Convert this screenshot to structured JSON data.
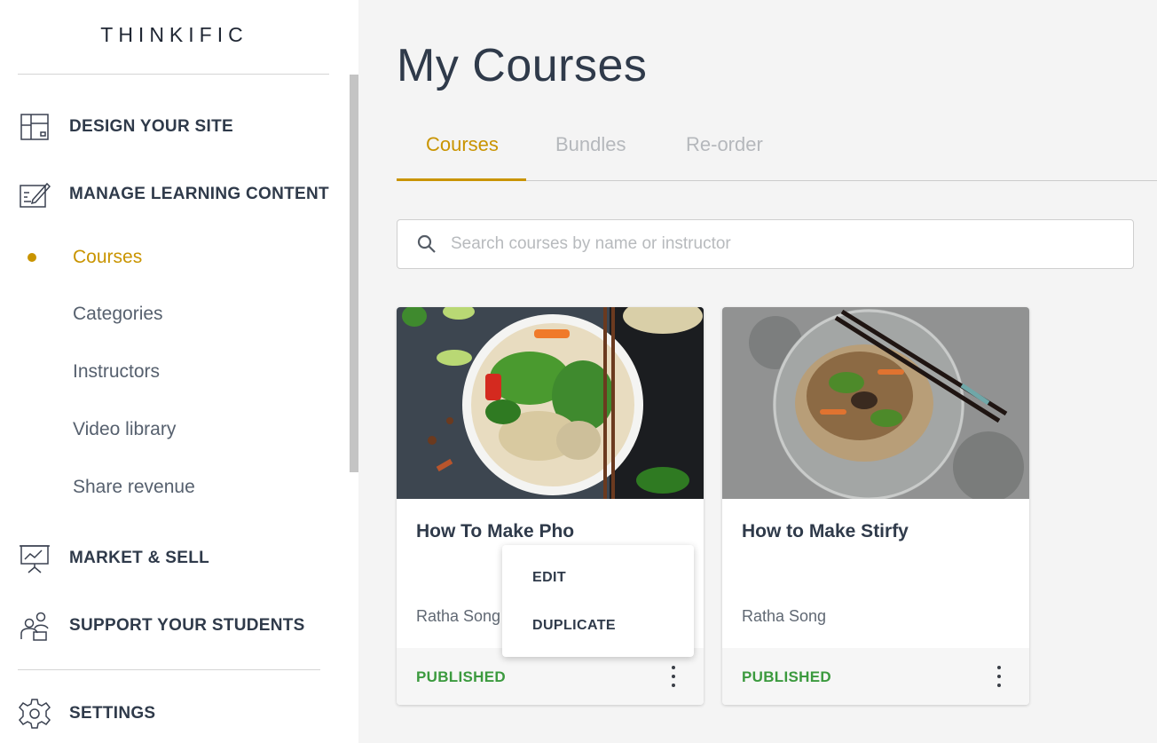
{
  "sidebar": {
    "logo": "THINKIFIC",
    "sections": {
      "design": {
        "label": "DESIGN YOUR SITE",
        "icon": "layout-icon"
      },
      "manage": {
        "label": "MANAGE LEARNING CONTENT",
        "icon": "edit-content-icon"
      },
      "market": {
        "label": "MARKET & SELL",
        "icon": "presentation-chart-icon"
      },
      "support": {
        "label": "SUPPORT YOUR STUDENTS",
        "icon": "students-icon"
      },
      "settings": {
        "label": "SETTINGS",
        "icon": "gear-icon"
      }
    },
    "sub_items": [
      "Courses",
      "Categories",
      "Instructors",
      "Video library",
      "Share revenue"
    ],
    "active_sub_item": "Courses",
    "accent_color": "#c99400"
  },
  "main": {
    "title": "My Courses",
    "tabs": [
      "Courses",
      "Bundles",
      "Re-order"
    ],
    "active_tab": "Courses",
    "search": {
      "placeholder": "Search courses by name or instructor",
      "value": ""
    },
    "courses": [
      {
        "title": "How To Make Pho",
        "author": "Ratha Song",
        "status": "PUBLISHED"
      },
      {
        "title": "How to Make Stirfy",
        "author": "Ratha Song",
        "status": "PUBLISHED"
      }
    ],
    "context_menu": {
      "items": [
        "EDIT",
        "DUPLICATE"
      ]
    },
    "status_color": "#3b9a3e"
  }
}
